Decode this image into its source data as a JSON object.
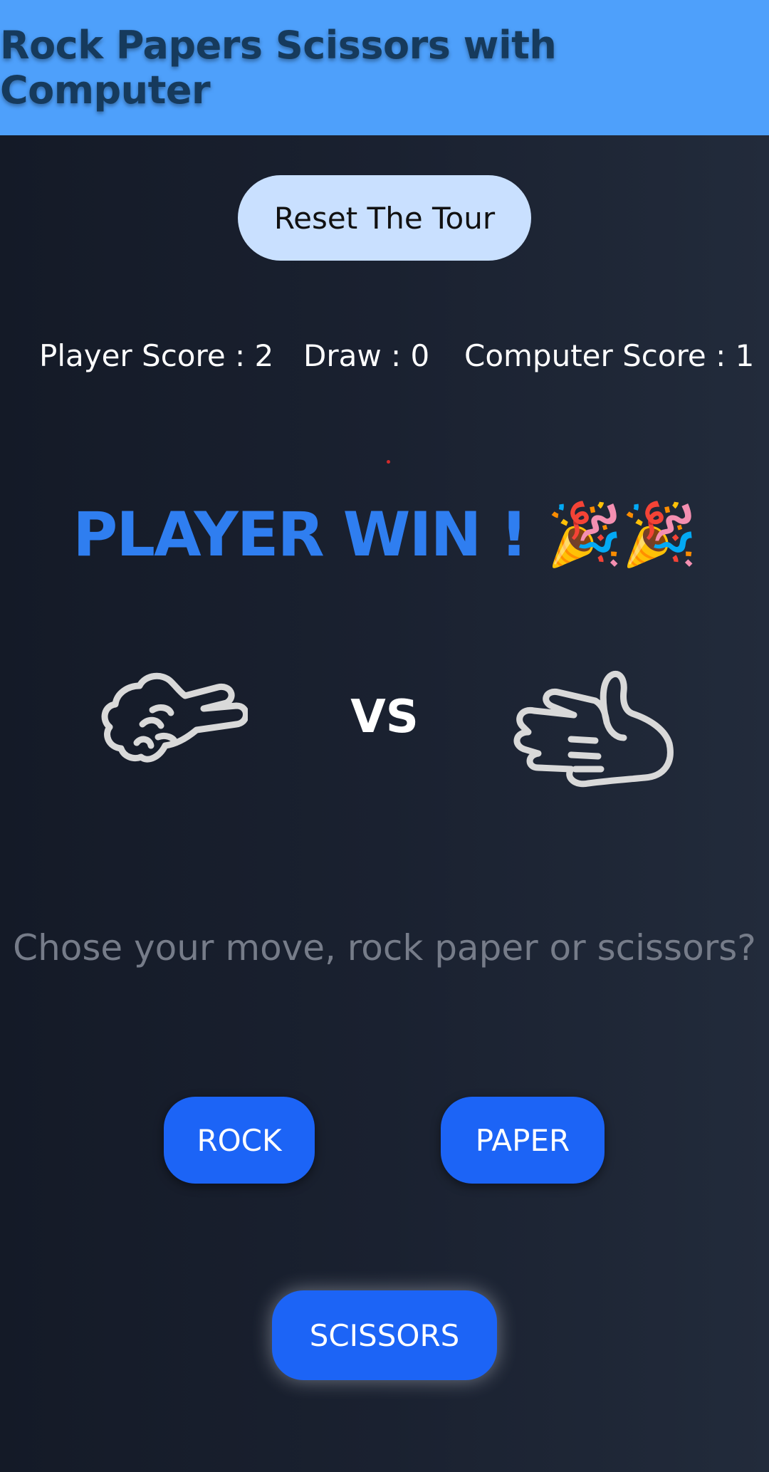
{
  "header": {
    "title": "Rock Papers Scissors with Computer"
  },
  "reset_button": {
    "label": "Reset The Tour"
  },
  "scores": {
    "player": "Player Score : 2",
    "draw": "Draw : 0",
    "computer": "Computer Score : 1"
  },
  "result": {
    "text": "PLAYER WIN ! 🎉🎉"
  },
  "match": {
    "player_hand": "scissors-hand-icon",
    "vs_label": "VS",
    "computer_hand": "paper-hand-icon"
  },
  "prompt": {
    "text": "Chose your move, rock paper or scissors?"
  },
  "moves": {
    "rock_label": "ROCK",
    "paper_label": "PAPER",
    "scissors_label": "SCISSORS"
  },
  "colors": {
    "header_bg": "#4ea0fb",
    "accent_blue": "#1c64f6",
    "result_blue": "#2f7ef0",
    "reset_bg": "#c9e0ff",
    "page_bg": "#1a2130"
  }
}
